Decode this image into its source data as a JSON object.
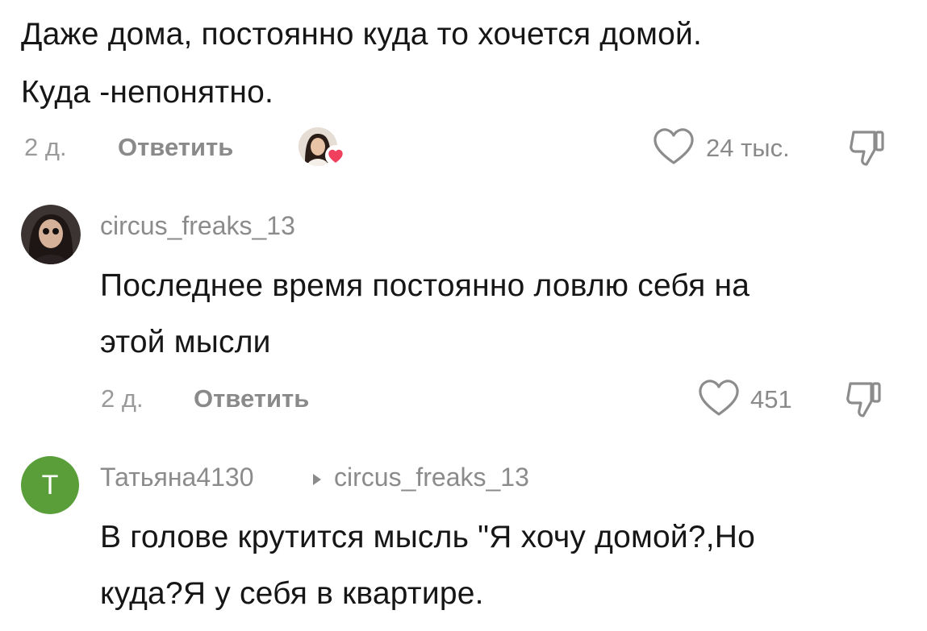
{
  "comment_top": {
    "text_line1": "Даже дома, постоянно куда то хочется домой.",
    "text_line2": "Куда -непонятно.",
    "time": "2 д.",
    "reply_label": "Ответить",
    "likes": "24 тыс."
  },
  "comment_circus": {
    "username": "circus_freaks_13",
    "text_line1": "Последнее время постоянно ловлю себя на",
    "text_line2": "этой мысли",
    "time": "2 д.",
    "reply_label": "Ответить",
    "likes": "451"
  },
  "comment_tatyana": {
    "avatar_letter": "Т",
    "avatar_color": "#5a9e3a",
    "username": "Татьяна4130",
    "reply_to": "circus_freaks_13",
    "text_line1": "В голове крутится мысль \"Я хочу домой?,Но",
    "text_line2": "куда?Я у себя в квартире."
  },
  "colors": {
    "heart_badge": "#f0405e",
    "muted_text": "#8a8a8a"
  }
}
